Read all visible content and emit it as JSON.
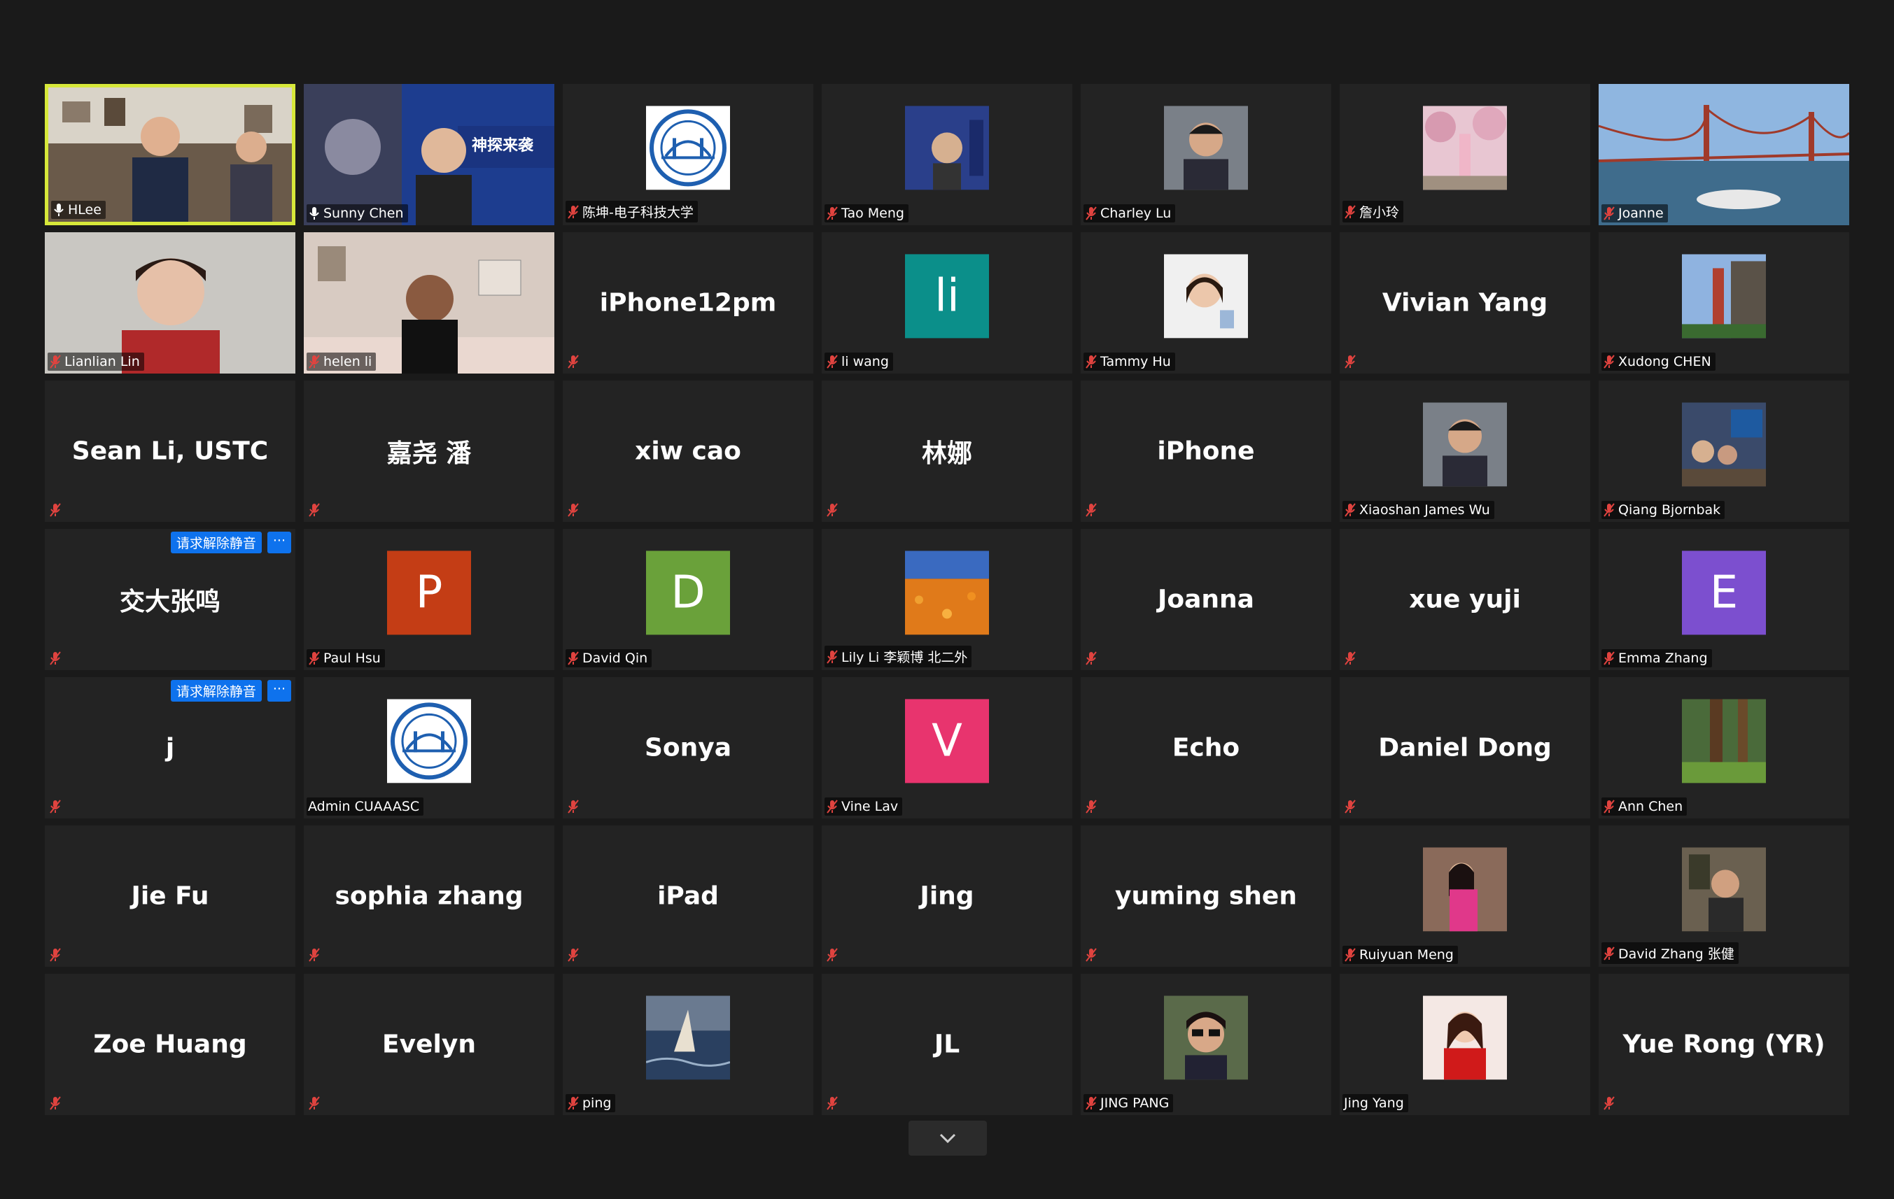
{
  "colors": {
    "speaker_border": "#d7e83a",
    "muted_icon": "#e0433f",
    "request_button": "#0e72ed"
  },
  "request_unmute": {
    "label": "请求解除静音",
    "more": "···"
  },
  "tiles": [
    {
      "name": "HLee",
      "type": "video",
      "scene": "office",
      "speaker": true,
      "mic": "unmuted"
    },
    {
      "name": "Sunny Chen",
      "type": "video",
      "scene": "poster",
      "mic": "unmuted"
    },
    {
      "name": "陈坤-电子科技大学",
      "type": "logo",
      "mic": "muted"
    },
    {
      "name": "Tao Meng",
      "type": "photo",
      "scene": "poster-small",
      "mic": "muted"
    },
    {
      "name": "Charley Lu",
      "type": "photo",
      "scene": "portrait",
      "mic": "muted"
    },
    {
      "name": "詹小玲",
      "type": "photo",
      "scene": "blossom",
      "mic": "muted"
    },
    {
      "name": "Joanne",
      "type": "video",
      "scene": "bridge",
      "mic": "muted"
    },
    {
      "name": "Lianlian Lin",
      "type": "video",
      "scene": "woman",
      "mic": "muted"
    },
    {
      "name": "helen li",
      "type": "video",
      "scene": "room",
      "mic": "muted"
    },
    {
      "name": "iPhone12pm",
      "type": "text",
      "mic": "muted",
      "show_label": false
    },
    {
      "name": "li wang",
      "type": "avatar",
      "letter": "li",
      "color": "#0b8f8a",
      "mic": "muted"
    },
    {
      "name": "Tammy Hu",
      "type": "photo",
      "scene": "portrait-light",
      "mic": "muted"
    },
    {
      "name": "Vivian Yang",
      "type": "text",
      "mic": "muted",
      "show_label": false
    },
    {
      "name": "Xudong CHEN",
      "type": "photo",
      "scene": "tower",
      "mic": "muted"
    },
    {
      "name": "Sean Li, USTC",
      "type": "text",
      "mic": "muted",
      "show_label": false
    },
    {
      "name": "嘉尧 潘",
      "type": "text",
      "mic": "muted",
      "show_label": false
    },
    {
      "name": "xiw cao",
      "type": "text",
      "mic": "muted",
      "show_label": false
    },
    {
      "name": "林娜",
      "type": "text",
      "mic": "muted",
      "show_label": false
    },
    {
      "name": "iPhone",
      "type": "text",
      "mic": "muted",
      "show_label": false
    },
    {
      "name": "Xiaoshan James Wu",
      "type": "photo",
      "scene": "portrait",
      "mic": "muted"
    },
    {
      "name": "Qiang Bjornbak",
      "type": "photo",
      "scene": "group",
      "mic": "muted"
    },
    {
      "name": "交大张鸣",
      "type": "text",
      "mic": "muted",
      "show_label": false,
      "request": true
    },
    {
      "name": "Paul Hsu",
      "type": "avatar",
      "letter": "P",
      "color": "#c43d15",
      "mic": "muted"
    },
    {
      "name": "David Qin",
      "type": "avatar",
      "letter": "D",
      "color": "#6aa13a",
      "mic": "muted"
    },
    {
      "name": "Lily Li 李颖博 北二外",
      "type": "photo",
      "scene": "poppies",
      "mic": "muted"
    },
    {
      "name": "Joanna",
      "type": "text",
      "mic": "muted",
      "show_label": false
    },
    {
      "name": "xue yuji",
      "type": "text",
      "mic": "muted",
      "show_label": false
    },
    {
      "name": "Emma Zhang",
      "type": "avatar",
      "letter": "E",
      "color": "#7c4fcf",
      "mic": "muted"
    },
    {
      "name": "j",
      "type": "text",
      "mic": "muted",
      "show_label": false,
      "request": true
    },
    {
      "name": "Admin CUAAASC",
      "type": "logo",
      "mic": "none"
    },
    {
      "name": "Sonya",
      "type": "text",
      "mic": "muted",
      "show_label": false
    },
    {
      "name": "Vine Lav",
      "type": "avatar",
      "letter": "V",
      "color": "#e8346e",
      "mic": "muted"
    },
    {
      "name": "Echo",
      "type": "text",
      "mic": "muted",
      "show_label": false
    },
    {
      "name": "Daniel Dong",
      "type": "text",
      "mic": "muted",
      "show_label": false
    },
    {
      "name": "Ann Chen",
      "type": "photo",
      "scene": "forest",
      "mic": "muted"
    },
    {
      "name": "Jie Fu",
      "type": "text",
      "mic": "muted",
      "show_label": false
    },
    {
      "name": "sophia zhang",
      "type": "text",
      "mic": "muted",
      "show_label": false
    },
    {
      "name": "iPad",
      "type": "text",
      "mic": "muted",
      "show_label": false
    },
    {
      "name": "Jing",
      "type": "text",
      "mic": "muted",
      "show_label": false
    },
    {
      "name": "yuming shen",
      "type": "text",
      "mic": "muted",
      "show_label": false
    },
    {
      "name": "Ruiyuan Meng",
      "type": "photo",
      "scene": "pink",
      "mic": "muted"
    },
    {
      "name": "David Zhang 张健",
      "type": "photo",
      "scene": "man-room",
      "mic": "muted"
    },
    {
      "name": "Zoe Huang",
      "type": "text",
      "mic": "muted",
      "show_label": false
    },
    {
      "name": "Evelyn",
      "type": "text",
      "mic": "muted",
      "show_label": false
    },
    {
      "name": "ping",
      "type": "photo",
      "scene": "sea",
      "mic": "muted"
    },
    {
      "name": "JL",
      "type": "text",
      "mic": "muted",
      "show_label": false
    },
    {
      "name": "JING PANG",
      "type": "photo",
      "scene": "sunglasses",
      "mic": "muted"
    },
    {
      "name": "Jing Yang",
      "type": "photo",
      "scene": "red",
      "mic": "none"
    },
    {
      "name": "Yue Rong (YR)",
      "type": "text",
      "mic": "muted",
      "show_label": false
    }
  ]
}
